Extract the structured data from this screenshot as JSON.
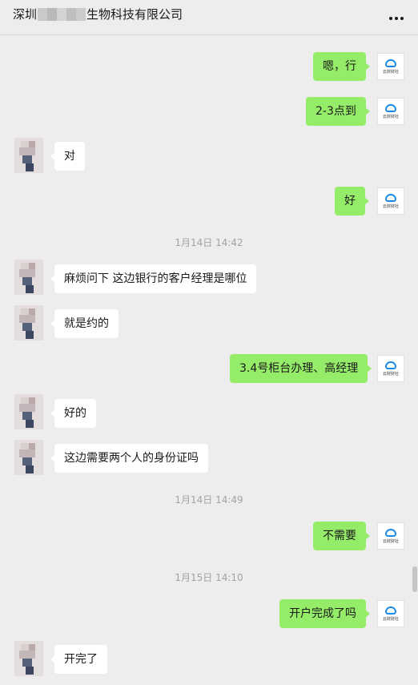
{
  "header": {
    "title_prefix": "深圳",
    "title_suffix": "生物科技有限公司",
    "more_icon": "more-horizontal-icon"
  },
  "avatars": {
    "me_brand": "云财财社"
  },
  "messages": [
    {
      "sender": "me",
      "text": "嗯，行"
    },
    {
      "sender": "me",
      "text": "2-3点到"
    },
    {
      "sender": "other",
      "text": "对"
    },
    {
      "sender": "me",
      "text": "好"
    },
    {
      "type": "time",
      "text": "1月14日 14:42"
    },
    {
      "sender": "other",
      "text": "麻烦问下 这边银行的客户经理是哪位"
    },
    {
      "sender": "other",
      "text": "就是约的"
    },
    {
      "sender": "me",
      "text": "3.4号柜台办理、高经理"
    },
    {
      "sender": "other",
      "text": "好的"
    },
    {
      "sender": "other",
      "text": "这边需要两个人的身份证吗"
    },
    {
      "type": "time",
      "text": "1月14日 14:49"
    },
    {
      "sender": "me",
      "text": "不需要"
    },
    {
      "type": "time",
      "text": "1月15日 14:10"
    },
    {
      "sender": "me",
      "text": "开户完成了吗"
    },
    {
      "sender": "other",
      "text": "开完了"
    }
  ]
}
